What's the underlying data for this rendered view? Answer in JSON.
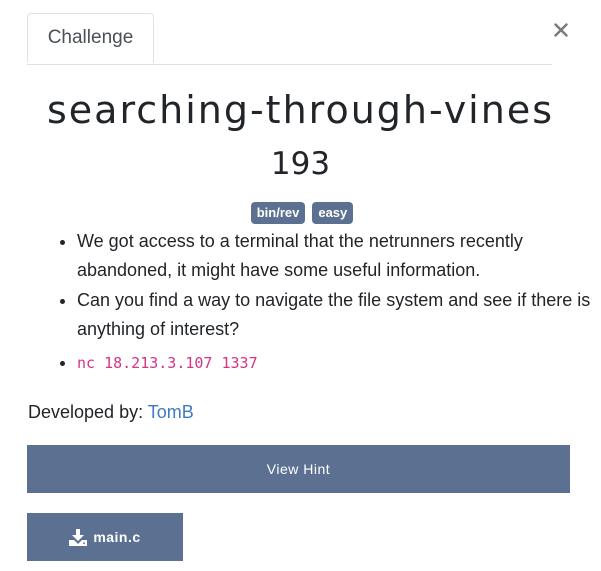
{
  "tabs": [
    {
      "label": "Challenge",
      "active": true
    }
  ],
  "close_label": "×",
  "challenge": {
    "title": "searching-through-vines",
    "points": "193",
    "tags": [
      "bin/rev",
      "easy"
    ],
    "description": [
      "We got access to a terminal that the netrunners recently abandoned, it might have some useful information.",
      "Can you find a way to navigate the file system and see if there is anything of interest?"
    ],
    "connection": "nc 18.213.3.107 1337",
    "developer_label": "Developed by:",
    "developer_name": "TomB"
  },
  "buttons": {
    "hint_label": "View Hint",
    "file_label": "main.c"
  },
  "colors": {
    "button_bg": "#5c7191",
    "link": "#3f7bc4",
    "code": "#d63384"
  },
  "icons": {
    "close": "close-icon",
    "download": "download-icon"
  }
}
